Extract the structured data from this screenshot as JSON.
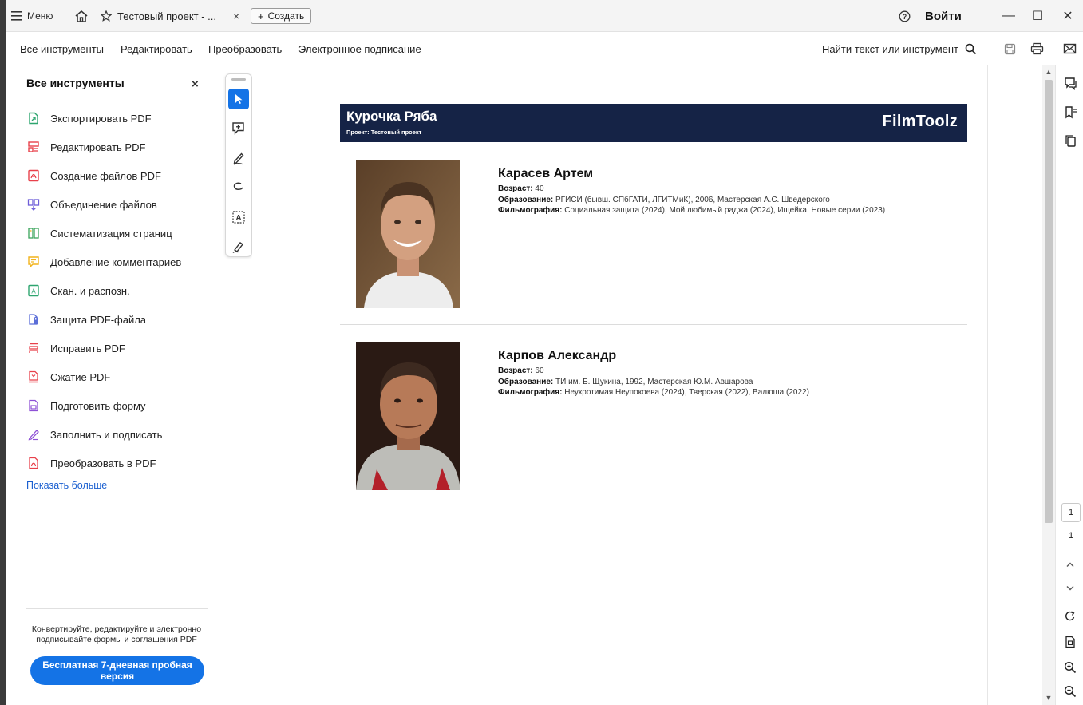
{
  "titlebar": {
    "menu_label": "Меню",
    "tab_title": "Тестовый проект - ...",
    "tab_close": "×",
    "create_label": "Создать",
    "login_label": "Войти",
    "minimize": "—",
    "maximize": "☐",
    "close": "✕"
  },
  "menubar": {
    "items": [
      "Все инструменты",
      "Редактировать",
      "Преобразовать",
      "Электронное подписание"
    ],
    "search_label": "Найти текст или инструмент"
  },
  "panel": {
    "title": "Все инструменты",
    "close": "×",
    "tools": [
      {
        "label": "Экспортировать PDF",
        "icon": "export-pdf-icon",
        "color": "#2da56f"
      },
      {
        "label": "Редактировать PDF",
        "icon": "edit-pdf-icon",
        "color": "#e8414b"
      },
      {
        "label": "Создание файлов PDF",
        "icon": "create-pdf-icon",
        "color": "#e8414b"
      },
      {
        "label": "Объединение файлов",
        "icon": "combine-files-icon",
        "color": "#6e5ed8"
      },
      {
        "label": "Систематизация страниц",
        "icon": "organize-pages-icon",
        "color": "#3aa45b"
      },
      {
        "label": "Добавление комментариев",
        "icon": "comment-icon",
        "color": "#f2b31c"
      },
      {
        "label": "Скан. и распозн.",
        "icon": "scan-ocr-icon",
        "color": "#2da56f"
      },
      {
        "label": "Защита PDF-файла",
        "icon": "protect-pdf-icon",
        "color": "#5b6ed8"
      },
      {
        "label": "Исправить PDF",
        "icon": "redact-pdf-icon",
        "color": "#e8414b"
      },
      {
        "label": "Сжатие PDF",
        "icon": "compress-pdf-icon",
        "color": "#e8414b"
      },
      {
        "label": "Подготовить форму",
        "icon": "prepare-form-icon",
        "color": "#8e51d6"
      },
      {
        "label": "Заполнить и подписать",
        "icon": "fill-sign-icon",
        "color": "#8e51d6"
      },
      {
        "label": "Преобразовать в PDF",
        "icon": "convert-to-pdf-icon",
        "color": "#e8414b"
      }
    ],
    "show_more": "Показать больше",
    "promo_text": "Конвертируйте, редактируйте и электронно подписывайте формы и соглашения PDF",
    "trial_button": "Бесплатная 7-дневная пробная версия"
  },
  "document": {
    "title": "Курочка Ряба",
    "subtitle": "Проект: Тестовый проект",
    "brand": "FilmToolz",
    "actors": [
      {
        "name": "Карасев Артем",
        "age_label": "Возраст:",
        "age": "40",
        "education_label": "Образование:",
        "education": "РГИСИ (бывш. СПбГАТИ, ЛГИТМиК), 2006, Мастерская А.С. Шведерского",
        "filmography_label": "Фильмография:",
        "filmography": "Социальная защита (2024), Мой любимый раджа (2024), Ищейка. Новые серии (2023)"
      },
      {
        "name": "Карпов Александр",
        "age_label": "Возраст:",
        "age": "60",
        "education_label": "Образование:",
        "education": "ТИ им. Б. Щукина, 1992, Мастерская Ю.М. Авшарова",
        "filmography_label": "Фильмография:",
        "filmography": "Неукротимая Неупокоева (2024), Тверская (2022), Валюша (2022)"
      }
    ]
  },
  "pagination": {
    "current": "1",
    "total": "1"
  },
  "colors": {
    "accent": "#1473e6",
    "doc_header": "#152346",
    "link": "#1a5fd0"
  }
}
